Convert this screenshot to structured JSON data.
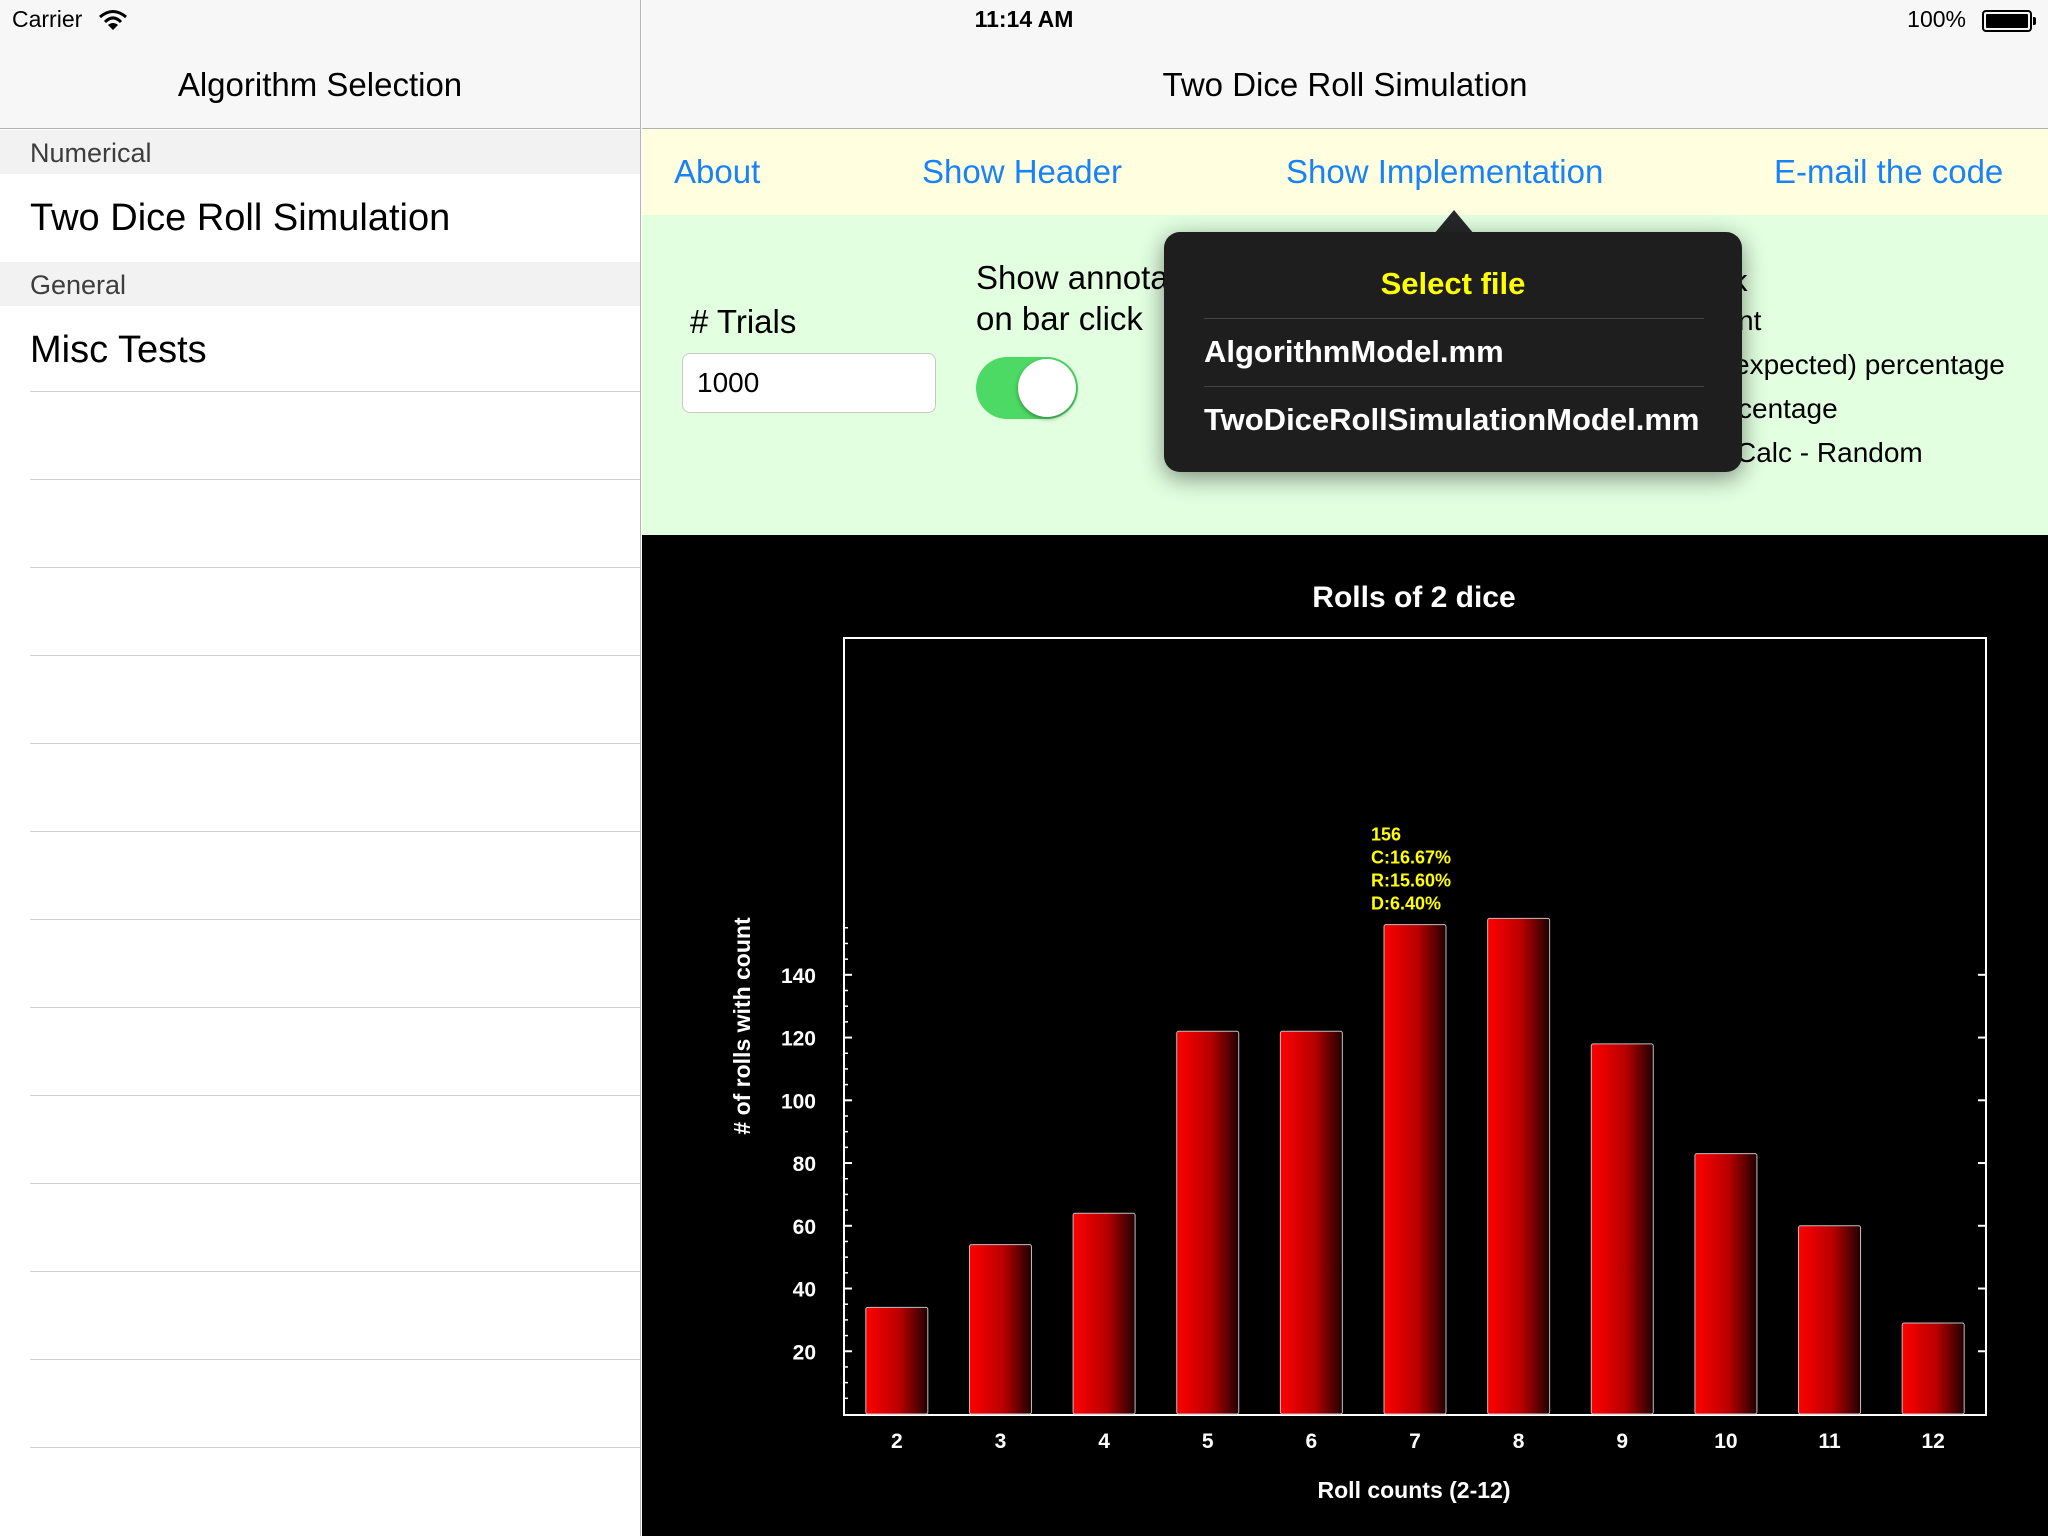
{
  "status_bar": {
    "carrier": "Carrier",
    "time": "11:14 AM",
    "battery": "100%"
  },
  "master": {
    "title": "Algorithm Selection",
    "sections": [
      {
        "header": "Numerical",
        "items": [
          "Two Dice Roll Simulation"
        ]
      },
      {
        "header": "General",
        "items": [
          "Misc Tests"
        ]
      }
    ]
  },
  "detail": {
    "title": "Two Dice Roll Simulation",
    "toolbar": {
      "about": "About",
      "show_header": "Show Header",
      "show_implementation": "Show Implementation",
      "email_code": "E-mail the code"
    },
    "controls": {
      "trials_label": "# Trials",
      "trials_value": "1000",
      "annotation_label_line1": "Show annota",
      "annotation_label_line2": "on bar click",
      "annotation_toggle_on": true,
      "radio_options": [
        "k",
        "nt",
        "expected) percentage",
        "centage",
        "Calc - Random"
      ]
    },
    "popover": {
      "title": "Select file",
      "items": [
        "AlgorithmModel.mm",
        "TwoDiceRollSimulationModel.mm"
      ]
    }
  },
  "colors": {
    "accent": "#1a82f7",
    "toolbar_bg": "#ffffe0",
    "controls_bg": "#e2ffe0",
    "toggle_on": "#4cd964",
    "bar": "#ee0000",
    "annotation": "#ffff00"
  },
  "icons": {
    "wifi": "wifi-icon",
    "battery": "battery-icon"
  },
  "chart_data": {
    "type": "bar",
    "title": "Rolls of 2 dice",
    "xlabel": "Roll counts (2-12)",
    "ylabel": "# of rolls with count",
    "categories": [
      "2",
      "3",
      "4",
      "5",
      "6",
      "7",
      "8",
      "9",
      "10",
      "11",
      "12"
    ],
    "values": [
      34,
      54,
      64,
      122,
      122,
      156,
      158,
      118,
      83,
      60,
      29
    ],
    "ylim": [
      0,
      190
    ],
    "yticks": [
      20,
      40,
      60,
      80,
      100,
      120,
      140
    ],
    "grid": false,
    "annotation": {
      "category": "7",
      "lines": [
        "156",
        "C:16.67%",
        "R:15.60%",
        "D:6.40%"
      ]
    }
  }
}
